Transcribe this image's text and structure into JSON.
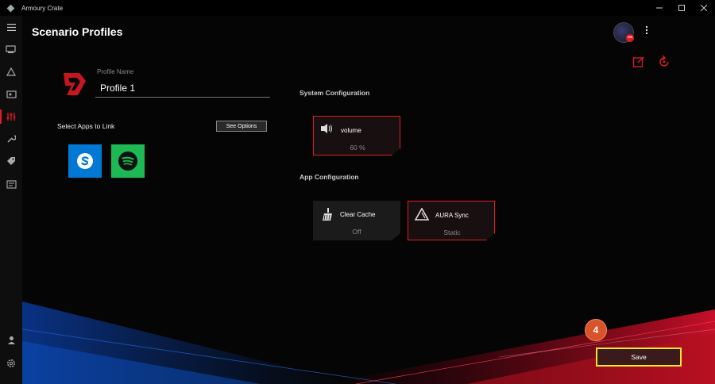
{
  "app": {
    "title": "Armoury Crate",
    "window_controls": [
      "minimize",
      "maximize",
      "close"
    ]
  },
  "sidebar": {
    "items": [
      {
        "icon": "menu-icon"
      },
      {
        "icon": "device-icon"
      },
      {
        "icon": "aura-icon"
      },
      {
        "icon": "gamevisual-icon"
      },
      {
        "icon": "scenario-profiles-icon",
        "active": true
      },
      {
        "icon": "tools-icon"
      },
      {
        "icon": "deals-icon"
      },
      {
        "icon": "news-icon"
      },
      {
        "icon": "user-center-icon"
      },
      {
        "icon": "settings-icon"
      }
    ]
  },
  "header": {
    "page_title": "Scenario Profiles"
  },
  "profile": {
    "name_label": "Profile Name",
    "name_value": "Profile 1"
  },
  "apps": {
    "label": "Select Apps to Link",
    "see_options_label": "See Options",
    "linked": [
      {
        "name": "skype-icon"
      },
      {
        "name": "spotify-icon"
      }
    ]
  },
  "system_configuration": {
    "label": "System Configuration",
    "cards": [
      {
        "title": "volume",
        "value": "60 %"
      }
    ]
  },
  "app_configuration": {
    "label": "App Configuration",
    "cards": [
      {
        "title": "Clear Cache",
        "value": "Off"
      },
      {
        "title": "AURA Sync",
        "value": "Static"
      }
    ]
  },
  "footer": {
    "step_badge": "4",
    "save_label": "Save"
  },
  "colors": {
    "accent": "#e31b23",
    "highlight": "#f2e62a",
    "badge": "#d9532a"
  }
}
